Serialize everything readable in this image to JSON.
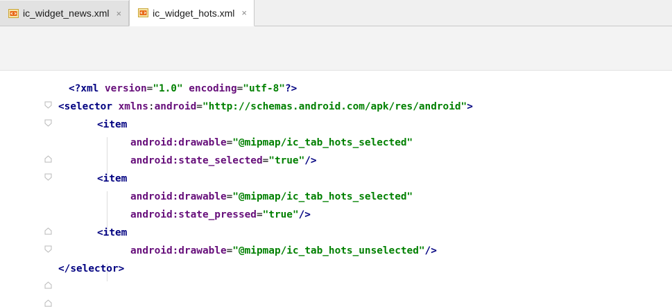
{
  "tabs": [
    {
      "label": "ic_widget_news.xml",
      "close": "×",
      "active": false
    },
    {
      "label": "ic_widget_hots.xml",
      "close": "×",
      "active": true
    }
  ],
  "code": {
    "l1": {
      "open": "<?",
      "name": "xml",
      "a1": " version",
      "eq1": "=",
      "v1": "\"1.0\"",
      "a2": " encoding",
      "eq2": "=",
      "v2": "\"utf-8\"",
      "close": "?>"
    },
    "l2": {
      "open": "<",
      "name": "selector",
      "ns": " xmlns",
      "colon": ":",
      "attr": "android",
      "eq": "=",
      "val": "\"http://schemas.android.com/apk/res/android\"",
      "close": ">"
    },
    "l3": {
      "open": "<",
      "name": "item"
    },
    "l4": {
      "attr": "android:drawable",
      "eq": "=",
      "val": "\"@mipmap/ic_tab_hots_selected\""
    },
    "l5": {
      "attr": "android:state_selected",
      "eq": "=",
      "val": "\"true\"",
      "close": "/>"
    },
    "l6": {
      "open": "<",
      "name": "item"
    },
    "l7": {
      "attr": "android:drawable",
      "eq": "=",
      "val": "\"@mipmap/ic_tab_hots_selected\""
    },
    "l8": {
      "attr": "android:state_pressed",
      "eq": "=",
      "val": "\"true\"",
      "close": "/>"
    },
    "l9": {
      "open": "<",
      "name": "item"
    },
    "l10": {
      "attr": "android:drawable",
      "eq": "=",
      "val": "\"@mipmap/ic_tab_hots_unselected\"",
      "close": "/>"
    },
    "l11": {
      "open": "</",
      "name": "selector",
      "close": ">"
    }
  },
  "colors": {
    "tag": "#000080",
    "attribute": "#660e7a",
    "value": "#008000",
    "tab_active_bg": "#ffffff",
    "tab_inactive_bg": "#e2e2e2"
  },
  "icons": {
    "tab_file": "xml-file-icon",
    "tab_close": "close-icon",
    "fold_open": "fold-open-icon",
    "fold_end": "fold-end-icon"
  }
}
